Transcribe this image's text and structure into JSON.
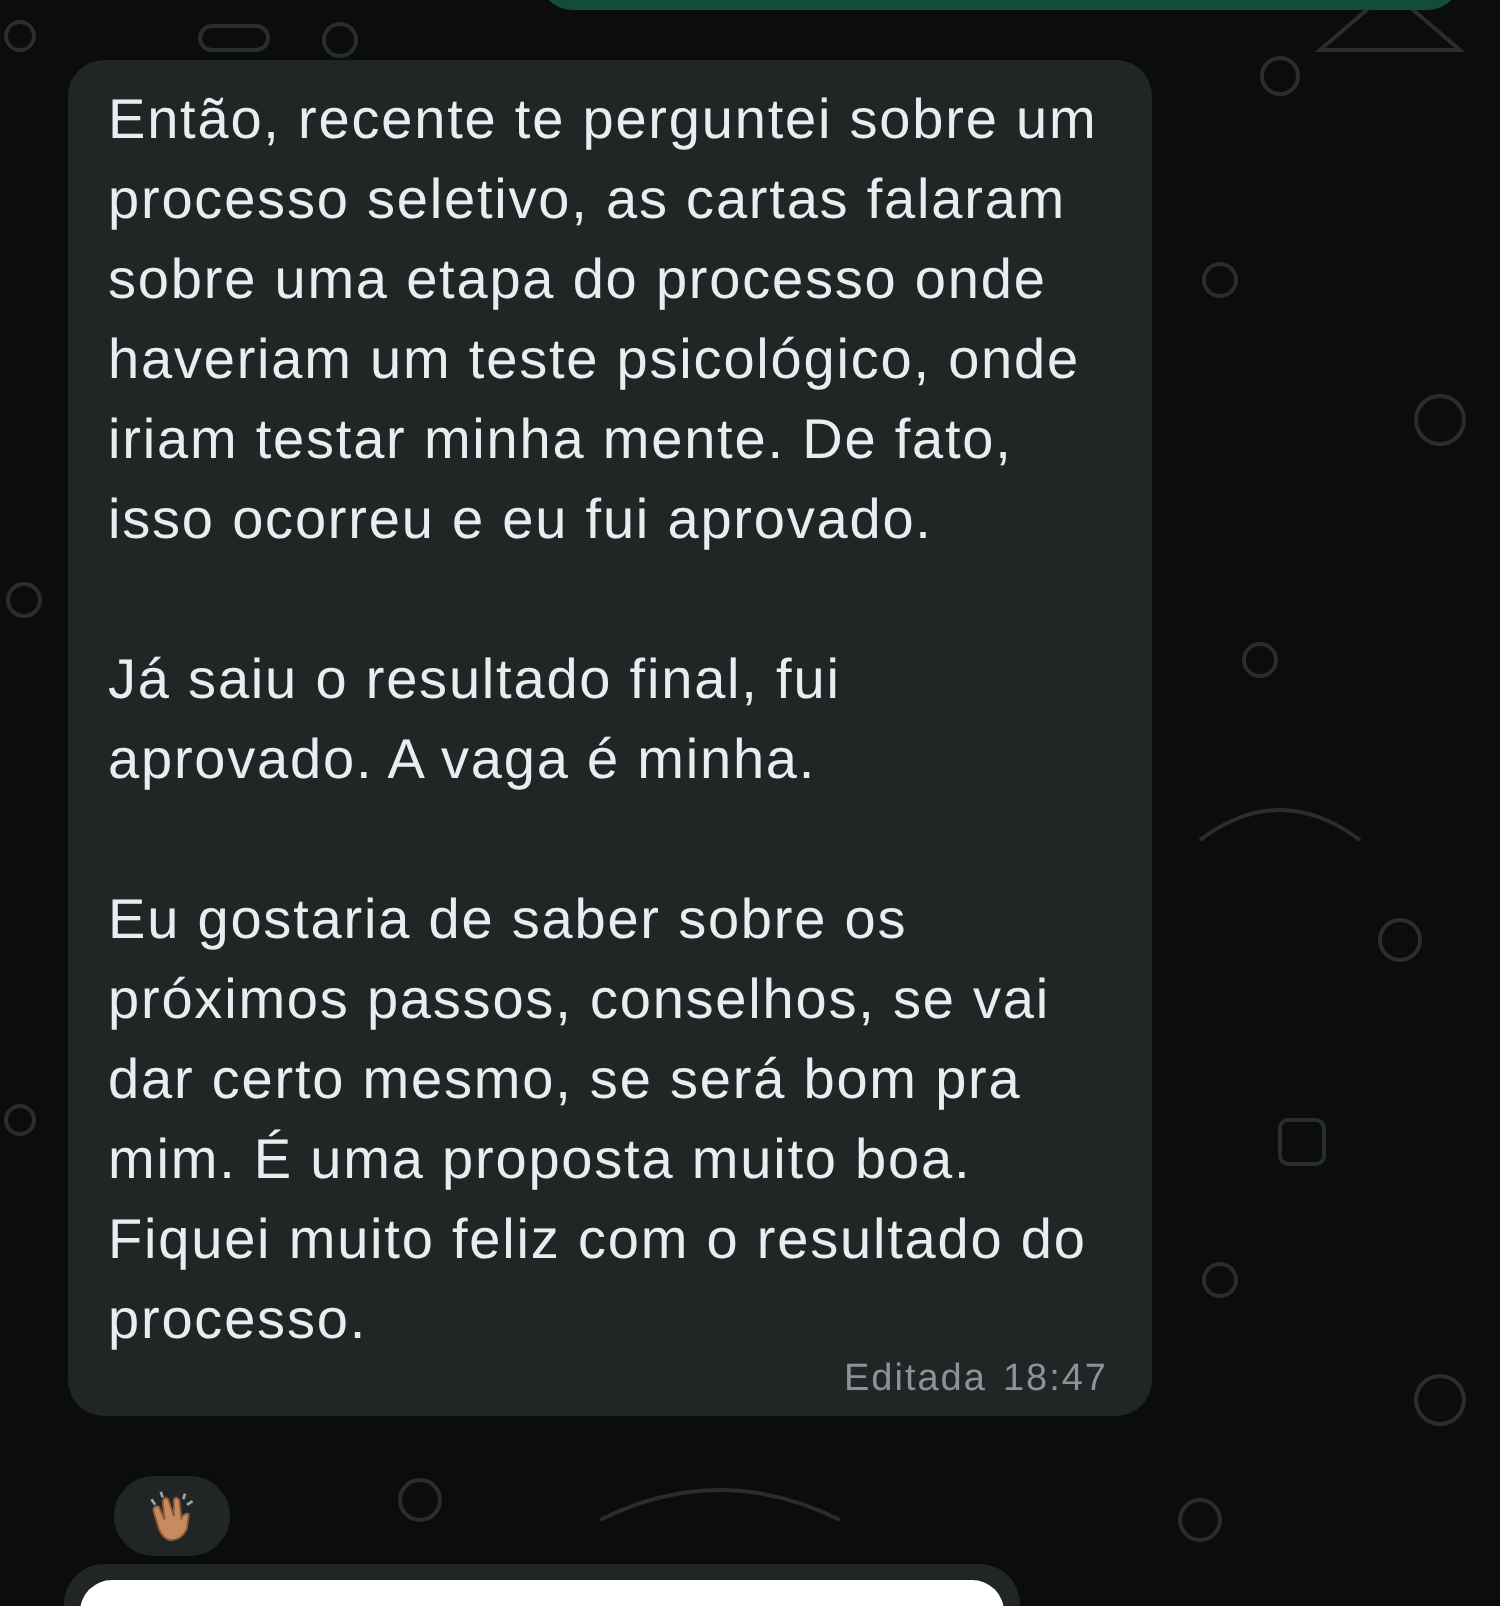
{
  "message": {
    "paragraphs": [
      "Então, recente te perguntei sobre um processo seletivo, as cartas falaram sobre uma etapa do processo onde haveriam um teste psicológico, onde iriam testar minha mente. De fato, isso ocorreu e eu fui aprovado.",
      "Já saiu o resultado final, fui aprovado. A vaga é minha.",
      "Eu gostaria de saber sobre os próximos passos, conselhos, se vai dar certo mesmo, se será bom pra mim. É uma proposta muito boa. Fiquei muito feliz com o resultado do processo."
    ],
    "edited_label": "Editada",
    "time": "18:47",
    "reaction": {
      "kind": "clap"
    }
  }
}
